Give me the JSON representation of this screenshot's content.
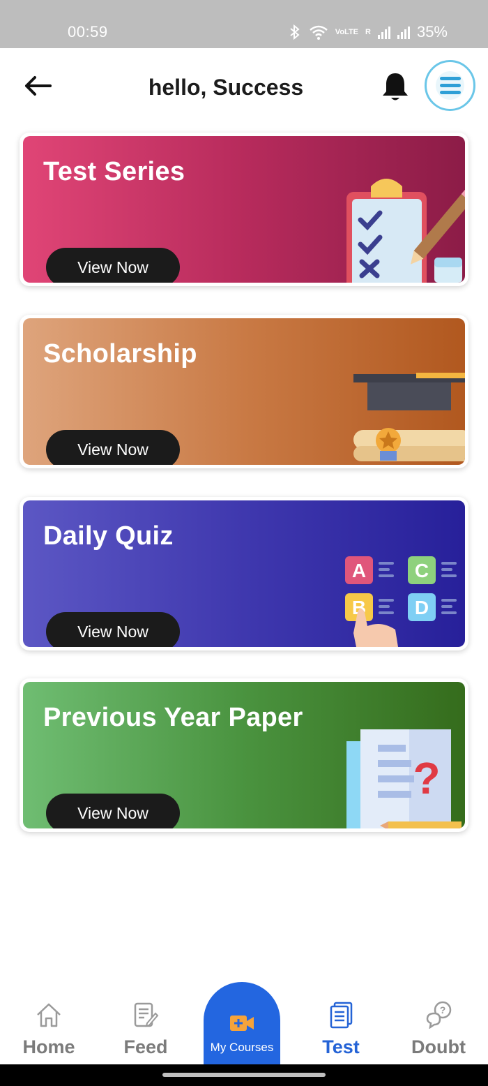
{
  "status_bar": {
    "time": "00:59",
    "network_label": "VoLTE",
    "roaming": "R",
    "battery": "35%"
  },
  "header": {
    "title": "hello, Success"
  },
  "cards": [
    {
      "title": "Test Series",
      "button_label": "View Now",
      "art_icon": "clipboard-checklist-icon",
      "gradient": [
        "#e04576",
        "#8c1c47"
      ]
    },
    {
      "title": "Scholarship",
      "button_label": "View Now",
      "art_icon": "graduation-cap-icon",
      "gradient": [
        "#dea47c",
        "#b1581f"
      ]
    },
    {
      "title": "Daily Quiz",
      "button_label": "View Now",
      "art_icon": "quiz-options-icon",
      "gradient": [
        "#5c57c4",
        "#27209a"
      ],
      "quiz_options": [
        "A",
        "B",
        "C",
        "D"
      ]
    },
    {
      "title": "Previous Year Paper",
      "button_label": "View Now",
      "art_icon": "question-paper-icon",
      "gradient": [
        "#6fbd72",
        "#356c1c"
      ]
    }
  ],
  "bottom_nav": {
    "items": [
      {
        "label": "Home",
        "icon": "home-icon",
        "active": false
      },
      {
        "label": "Feed",
        "icon": "feed-icon",
        "active": false
      },
      {
        "label": "My Courses",
        "icon": "video-camera-icon",
        "active": false
      },
      {
        "label": "Test",
        "icon": "test-icon",
        "active": true
      },
      {
        "label": "Doubt",
        "icon": "doubt-icon",
        "active": false
      }
    ]
  },
  "colors": {
    "accent": "#2366e0",
    "active_nav": "#2463d6",
    "menu_ring": "#6ac6e8",
    "status_bar": "#bdbdbd"
  }
}
